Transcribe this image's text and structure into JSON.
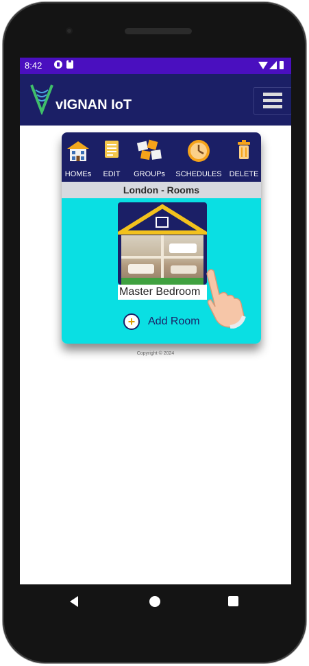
{
  "status_bar": {
    "time": "8:42",
    "icons": [
      "notification-icon",
      "sd-card-icon",
      "wifi-icon",
      "signal-icon",
      "battery-icon"
    ]
  },
  "app_bar": {
    "title": "vIGNAN IoT",
    "menu_icon": "hamburger-menu-icon",
    "color": "#1b1f66"
  },
  "toolbar": {
    "items": [
      {
        "label": "HOMEs",
        "icon": "house-icon"
      },
      {
        "label": "EDIT",
        "icon": "edit-document-icon"
      },
      {
        "label": "GROUPs",
        "icon": "puzzle-pieces-icon"
      },
      {
        "label": "SCHEDULES",
        "icon": "clock-icon"
      },
      {
        "label": "DELETE",
        "icon": "trash-icon"
      }
    ]
  },
  "subheader": "London - Rooms",
  "rooms": [
    {
      "name": "Master Bedroom"
    }
  ],
  "add_room_label": "Add Room",
  "copyright": "Copyright © 2024",
  "colors": {
    "accent_purple": "#4a0fbf",
    "navy": "#1b1f66",
    "cyan": "#0adfe3"
  },
  "nav": {
    "back": "back-icon",
    "home": "home-icon",
    "recent": "recent-apps-icon"
  }
}
